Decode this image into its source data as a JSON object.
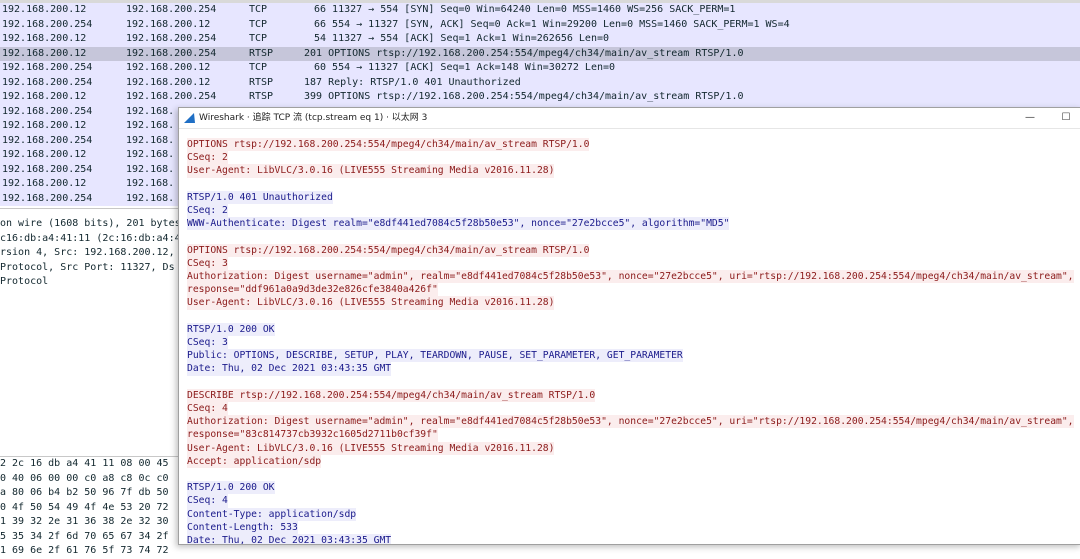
{
  "colors": {
    "row_lavender": "#e7e6ff",
    "row_selected": "#c6c6da",
    "client_text": "#8b1a1a",
    "client_bg": "#fbeded",
    "server_text": "#1a1a8b",
    "server_bg": "#ededfb",
    "title_icon": "#1f6fc5"
  },
  "packets": [
    {
      "src": "192.168.200.12",
      "dst": "192.168.200.254",
      "proto": "TCP",
      "info": "66 11327 → 554 [SYN] Seq=0 Win=64240 Len=0 MSS=1460 WS=256 SACK_PERM=1"
    },
    {
      "src": "192.168.200.254",
      "dst": "192.168.200.12",
      "proto": "TCP",
      "info": "66 554 → 11327 [SYN, ACK] Seq=0 Ack=1 Win=29200 Len=0 MSS=1460 SACK_PERM=1 WS=4"
    },
    {
      "src": "192.168.200.12",
      "dst": "192.168.200.254",
      "proto": "TCP",
      "info": "54 11327 → 554 [ACK] Seq=1 Ack=1 Win=262656 Len=0"
    },
    {
      "src": "192.168.200.12",
      "dst": "192.168.200.254",
      "proto": "RTSP",
      "info": "201 OPTIONS rtsp://192.168.200.254:554/mpeg4/ch34/main/av_stream RTSP/1.0"
    },
    {
      "src": "192.168.200.254",
      "dst": "192.168.200.12",
      "proto": "TCP",
      "info": "60 554 → 11327 [ACK] Seq=1 Ack=148 Win=30272 Len=0"
    },
    {
      "src": "192.168.200.254",
      "dst": "192.168.200.12",
      "proto": "RTSP",
      "info": "187 Reply: RTSP/1.0 401 Unauthorized"
    },
    {
      "src": "192.168.200.12",
      "dst": "192.168.200.254",
      "proto": "RTSP",
      "info": "399 OPTIONS rtsp://192.168.200.254:554/mpeg4/ch34/main/av_stream RTSP/1.0"
    },
    {
      "src": "192.168.200.254",
      "dst": "192.168.",
      "proto": "",
      "info": ""
    },
    {
      "src": "192.168.200.12",
      "dst": "192.168.",
      "proto": "",
      "info": ""
    },
    {
      "src": "192.168.200.254",
      "dst": "192.168.",
      "proto": "",
      "info": ""
    },
    {
      "src": "192.168.200.12",
      "dst": "192.168.",
      "proto": "",
      "info": ""
    },
    {
      "src": "192.168.200.254",
      "dst": "192.168.",
      "proto": "",
      "info": ""
    },
    {
      "src": "192.168.200.12",
      "dst": "192.168.",
      "proto": "",
      "info": ""
    },
    {
      "src": "192.168.200.254",
      "dst": "192.168.",
      "proto": "",
      "info": ""
    }
  ],
  "details": [
    "on wire (1608 bits), 201 bytes",
    "c16:db:a4:41:11 (2c:16:db:a4:4",
    "rsion 4, Src: 192.168.200.12, ",
    " Protocol, Src Port: 11327, Ds",
    "Protocol"
  ],
  "hex": [
    "2 2c 16  db a4 41 11 08 00 45",
    "0 40 06  00 00 c0 a8 c8 0c c0",
    "a 80 06  b4 b2 50 96 7f db 50",
    "0 4f 50  54 49 4f 4e 53 20 72",
    "1 39 32  2e 31 36 38 2e 32 30",
    "5 35 34  2f 6d 70 65 67 34 2f",
    "1 69 6e  2f 61 76 5f 73 74 72"
  ],
  "dialog": {
    "title": "Wireshark · 追踪 TCP 流 (tcp.stream eq 1) · 以太网 3",
    "minimize": "—",
    "maximize": "☐"
  },
  "stream": [
    {
      "dir": "client",
      "text": "OPTIONS rtsp://192.168.200.254:554/mpeg4/ch34/main/av_stream RTSP/1.0"
    },
    {
      "dir": "client",
      "text": "CSeq: 2"
    },
    {
      "dir": "client",
      "text": "User-Agent: LibVLC/3.0.16 (LIVE555 Streaming Media v2016.11.28)"
    },
    {
      "dir": "blank",
      "text": ""
    },
    {
      "dir": "server",
      "text": "RTSP/1.0 401 Unauthorized"
    },
    {
      "dir": "server",
      "text": "CSeq: 2"
    },
    {
      "dir": "server",
      "text": "WWW-Authenticate: Digest realm=\"e8df441ed7084c5f28b50e53\", nonce=\"27e2bcce5\", algorithm=\"MD5\""
    },
    {
      "dir": "blank",
      "text": ""
    },
    {
      "dir": "client",
      "text": "OPTIONS rtsp://192.168.200.254:554/mpeg4/ch34/main/av_stream RTSP/1.0"
    },
    {
      "dir": "client",
      "text": "CSeq: 3"
    },
    {
      "dir": "client",
      "text": "Authorization: Digest username=\"admin\", realm=\"e8df441ed7084c5f28b50e53\", nonce=\"27e2bcce5\", uri=\"rtsp://192.168.200.254:554/mpeg4/ch34/main/av_stream\","
    },
    {
      "dir": "client",
      "text": "response=\"ddf961a0a9d3de32e826cfe3840a426f\""
    },
    {
      "dir": "client",
      "text": "User-Agent: LibVLC/3.0.16 (LIVE555 Streaming Media v2016.11.28)"
    },
    {
      "dir": "blank",
      "text": ""
    },
    {
      "dir": "server",
      "text": "RTSP/1.0 200 OK"
    },
    {
      "dir": "server",
      "text": "CSeq: 3"
    },
    {
      "dir": "server",
      "text": "Public: OPTIONS, DESCRIBE, SETUP, PLAY, TEARDOWN, PAUSE, SET_PARAMETER, GET_PARAMETER"
    },
    {
      "dir": "server",
      "text": "Date: Thu, 02 Dec 2021 03:43:35 GMT"
    },
    {
      "dir": "blank",
      "text": ""
    },
    {
      "dir": "client",
      "text": "DESCRIBE rtsp://192.168.200.254:554/mpeg4/ch34/main/av_stream RTSP/1.0"
    },
    {
      "dir": "client",
      "text": "CSeq: 4"
    },
    {
      "dir": "client",
      "text": "Authorization: Digest username=\"admin\", realm=\"e8df441ed7084c5f28b50e53\", nonce=\"27e2bcce5\", uri=\"rtsp://192.168.200.254:554/mpeg4/ch34/main/av_stream\","
    },
    {
      "dir": "client",
      "text": "response=\"83c814737cb3932c1605d2711b0cf39f\""
    },
    {
      "dir": "client",
      "text": "User-Agent: LibVLC/3.0.16 (LIVE555 Streaming Media v2016.11.28)"
    },
    {
      "dir": "client",
      "text": "Accept: application/sdp"
    },
    {
      "dir": "blank",
      "text": ""
    },
    {
      "dir": "server",
      "text": "RTSP/1.0 200 OK"
    },
    {
      "dir": "server",
      "text": "CSeq: 4"
    },
    {
      "dir": "server",
      "text": "Content-Type: application/sdp"
    },
    {
      "dir": "server",
      "text": "Content-Length: 533"
    },
    {
      "dir": "server",
      "text": "Date: Thu, 02 Dec 2021 03:43:35 GMT"
    }
  ]
}
